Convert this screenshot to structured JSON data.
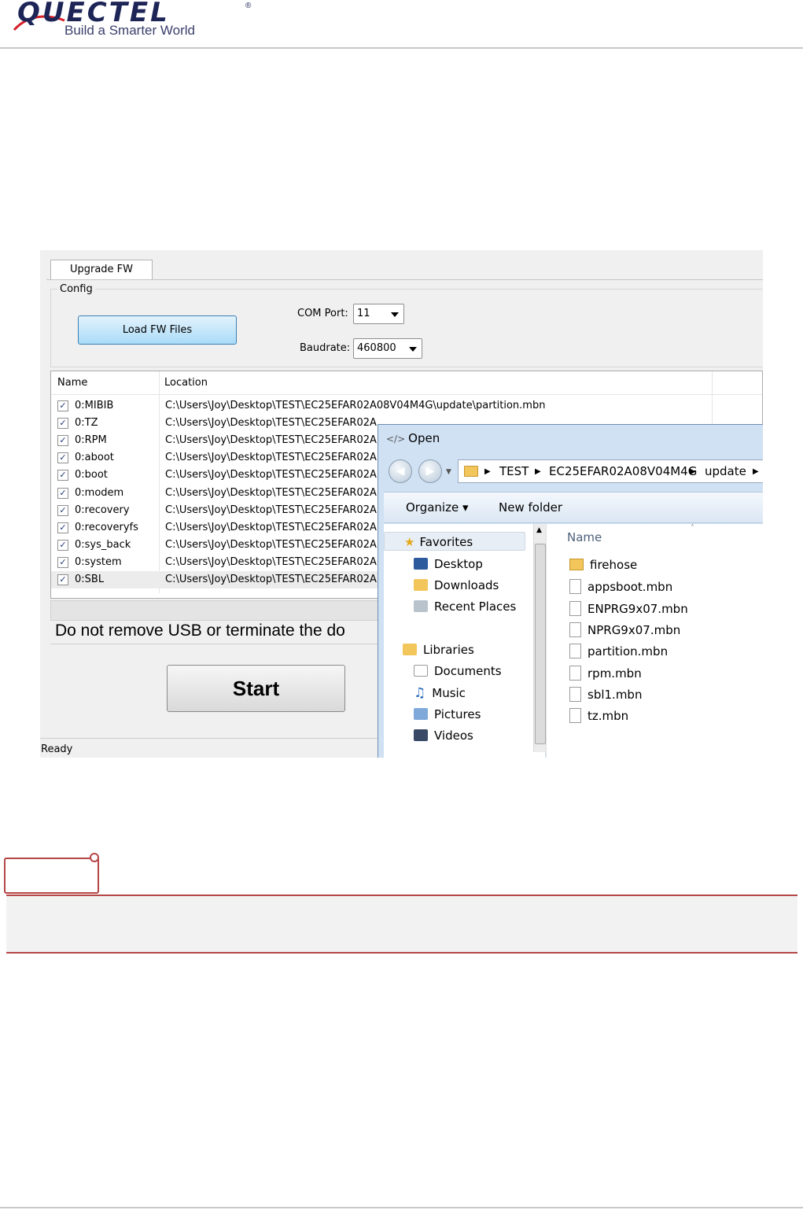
{
  "header": {
    "logo_text": "QUECTEL",
    "registered_mark": "®",
    "tagline": "Build a Smarter World"
  },
  "app": {
    "tab_label": "Upgrade FW",
    "config_label": "Config",
    "load_button": "Load FW Files",
    "com_port_label": "COM Port:",
    "com_port_value": "11",
    "baudrate_label": "Baudrate:",
    "baudrate_value": "460800",
    "columns": [
      "Name",
      "Location"
    ],
    "rows": [
      {
        "name": "0:MIBIB",
        "location": "C:\\Users\\Joy\\Desktop\\TEST\\EC25EFAR02A08V04M4G\\update\\partition.mbn",
        "checked": true
      },
      {
        "name": "0:TZ",
        "location": "C:\\Users\\Joy\\Desktop\\TEST\\EC25EFAR02A",
        "checked": true
      },
      {
        "name": "0:RPM",
        "location": "C:\\Users\\Joy\\Desktop\\TEST\\EC25EFAR02A",
        "checked": true
      },
      {
        "name": "0:aboot",
        "location": "C:\\Users\\Joy\\Desktop\\TEST\\EC25EFAR02A",
        "checked": true
      },
      {
        "name": "0:boot",
        "location": "C:\\Users\\Joy\\Desktop\\TEST\\EC25EFAR02A",
        "checked": true
      },
      {
        "name": "0:modem",
        "location": "C:\\Users\\Joy\\Desktop\\TEST\\EC25EFAR02A",
        "checked": true
      },
      {
        "name": "0:recovery",
        "location": "C:\\Users\\Joy\\Desktop\\TEST\\EC25EFAR02A",
        "checked": true
      },
      {
        "name": "0:recoveryfs",
        "location": "C:\\Users\\Joy\\Desktop\\TEST\\EC25EFAR02A",
        "checked": true
      },
      {
        "name": "0:sys_back",
        "location": "C:\\Users\\Joy\\Desktop\\TEST\\EC25EFAR02A",
        "checked": true
      },
      {
        "name": "0:system",
        "location": "C:\\Users\\Joy\\Desktop\\TEST\\EC25EFAR02A",
        "checked": true
      },
      {
        "name": "0:SBL",
        "location": "C:\\Users\\Joy\\Desktop\\TEST\\EC25EFAR02A",
        "checked": true
      }
    ],
    "warning": "Do not remove USB or terminate the do",
    "start_button": "Start",
    "status": "Ready"
  },
  "dialog": {
    "title": "Open",
    "breadcrumb": [
      "TEST",
      "EC25EFAR02A08V04M4G",
      "update"
    ],
    "organize": "Organize ▾",
    "new_folder": "New folder",
    "nav": {
      "favorites": "Favorites",
      "desktop": "Desktop",
      "downloads": "Downloads",
      "recent": "Recent Places",
      "libraries": "Libraries",
      "documents": "Documents",
      "music": "Music",
      "pictures": "Pictures",
      "videos": "Videos"
    },
    "files_header": "Name",
    "files": [
      "firehose",
      "appsboot.mbn",
      "ENPRG9x07.mbn",
      "NPRG9x07.mbn",
      "partition.mbn",
      "rpm.mbn",
      "sbl1.mbn",
      "tz.mbn"
    ]
  },
  "colors": {
    "brand": "#1d2557",
    "note_accent": "#b54646",
    "button_blue": "#a9dbf7"
  }
}
